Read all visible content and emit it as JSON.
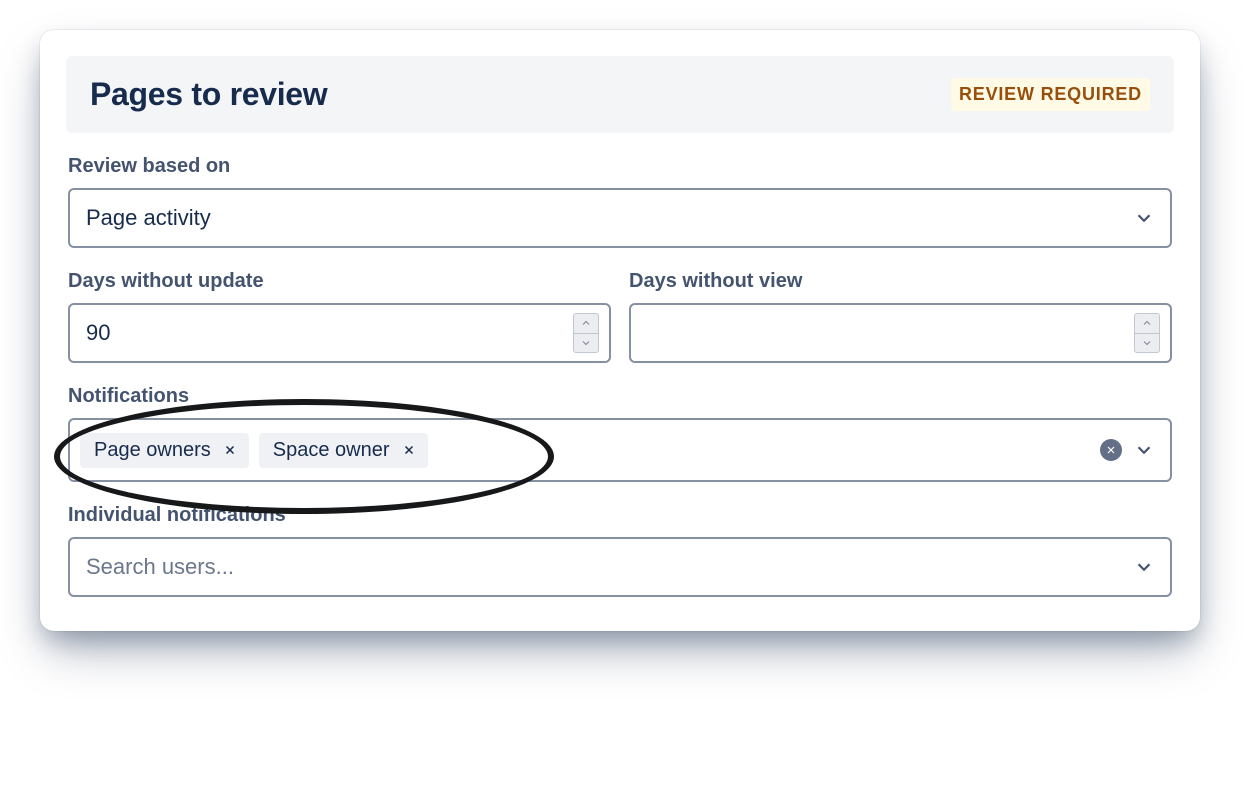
{
  "header": {
    "title": "Pages to review",
    "badge": "REVIEW REQUIRED"
  },
  "fields": {
    "review_basis": {
      "label": "Review based on",
      "value": "Page activity"
    },
    "days_no_update": {
      "label": "Days without update",
      "value": "90"
    },
    "days_no_view": {
      "label": "Days without view",
      "value": ""
    },
    "notifications": {
      "label": "Notifications",
      "tags": [
        "Page owners",
        "Space owner"
      ]
    },
    "individual": {
      "label": "Individual notifications",
      "placeholder": "Search users..."
    }
  }
}
